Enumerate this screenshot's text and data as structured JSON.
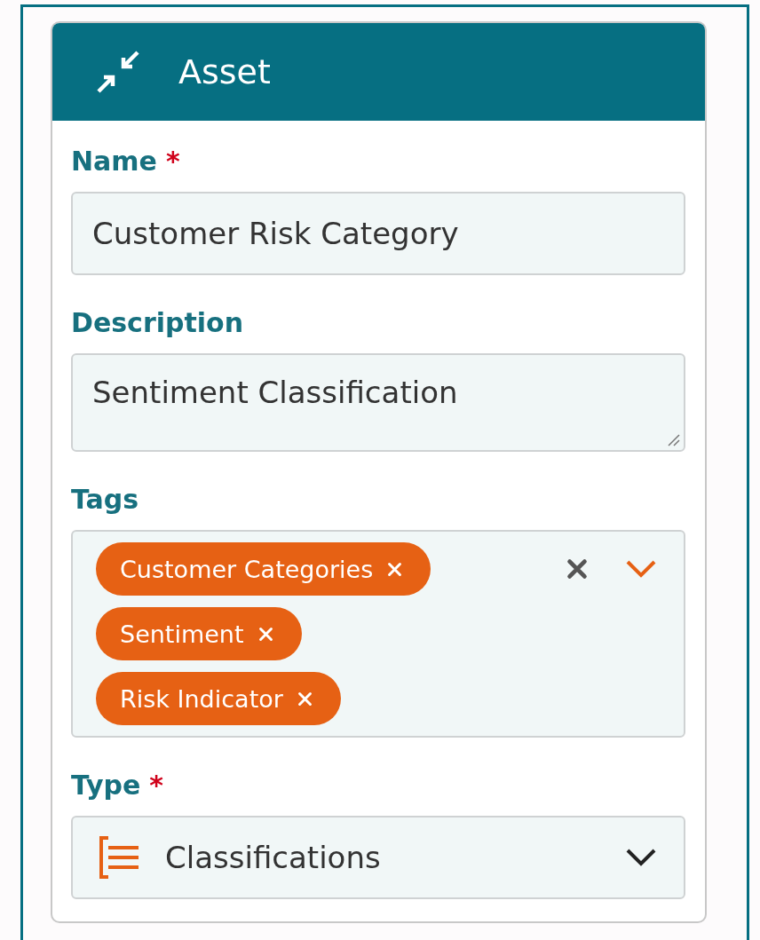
{
  "panel": {
    "title": "Asset"
  },
  "fields": [
    {
      "kind": "text",
      "label": "Name",
      "required_mark": "*",
      "value": "Customer Risk Category"
    },
    {
      "kind": "textarea",
      "label": "Description",
      "value": "Sentiment Classification"
    },
    {
      "kind": "tags",
      "label": "Tags",
      "tags": [
        "Customer Categories",
        "Sentiment",
        "Risk Indicator"
      ]
    },
    {
      "kind": "select",
      "label": "Type",
      "required_mark": "*",
      "value": "Classifications"
    }
  ]
}
